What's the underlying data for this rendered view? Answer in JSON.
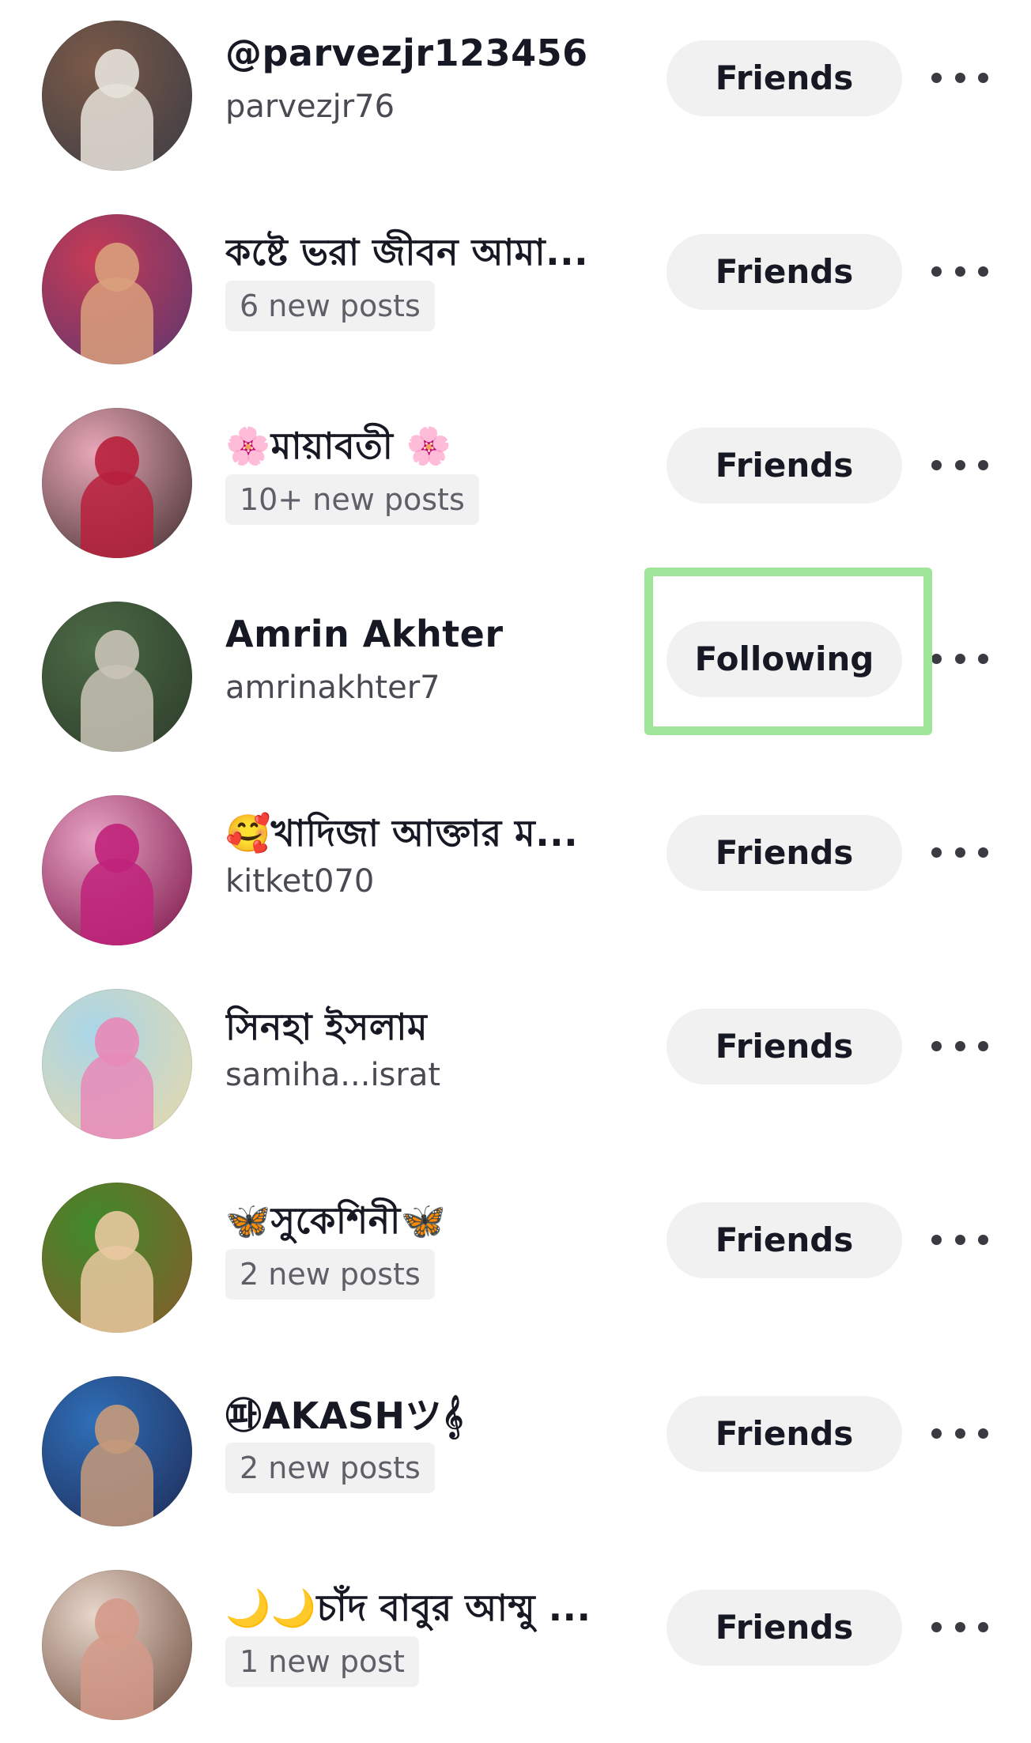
{
  "users": [
    {
      "name": "@parvezjr123456",
      "subtitle": "parvezjr76",
      "subtitle_type": "username",
      "button": "Friends",
      "avatar_colors": [
        "#7b5a48",
        "#e7e3db",
        "#3b3b44"
      ]
    },
    {
      "name": "কষ্টে ভরা জীবন আমা...",
      "subtitle": "6 new posts",
      "subtitle_type": "badge",
      "button": "Friends",
      "avatar_colors": [
        "#c73a55",
        "#d9a07c",
        "#5b3870"
      ]
    },
    {
      "name": "🌸মায়াবতী 🌸",
      "subtitle": "10+ new posts",
      "subtitle_type": "badge",
      "button": "Friends",
      "avatar_colors": [
        "#e8a7b8",
        "#b8203c",
        "#3f2c2c"
      ]
    },
    {
      "name": "Amrin Akhter",
      "subtitle": "amrinakhter7",
      "subtitle_type": "username",
      "button": "Following",
      "avatar_colors": [
        "#4b6a45",
        "#c9c3b6",
        "#2d3b2a"
      ]
    },
    {
      "name": "🥰খাদিজা আক্তার ম...",
      "subtitle": "kitket070",
      "subtitle_type": "username",
      "button": "Friends",
      "avatar_colors": [
        "#e7a3c4",
        "#c0227a",
        "#7a1146"
      ]
    },
    {
      "name": "সিনহা ইসলাম",
      "subtitle": "samiha...israt",
      "subtitle_type": "username",
      "button": "Friends",
      "avatar_colors": [
        "#a9d6e8",
        "#e889b8",
        "#e9d8a8"
      ]
    },
    {
      "name": "🦋সুকেশিনী🦋",
      "subtitle": "2 new posts",
      "subtitle_type": "badge",
      "button": "Friends",
      "avatar_colors": [
        "#3f8a2a",
        "#e9c9a0",
        "#8a5a2c"
      ]
    },
    {
      "name": "㉺AKASHツ𝄞",
      "subtitle": "2 new posts",
      "subtitle_type": "badge",
      "button": "Friends",
      "avatar_colors": [
        "#2f6fb8",
        "#c79a7a",
        "#1f2a55"
      ]
    },
    {
      "name": "🌙🌙চাঁদ বাবুর আম্মু ...",
      "subtitle": "1 new post",
      "subtitle_type": "badge",
      "button": "Friends",
      "avatar_colors": [
        "#e8d6cb",
        "#d49a8a",
        "#6b4a3a"
      ]
    }
  ],
  "accent": {
    "highlight_box": "#9ee59a",
    "button_bg": "#f1f1f2",
    "text": "#161823"
  },
  "icons": {
    "more": "more-horizontal-icon"
  }
}
